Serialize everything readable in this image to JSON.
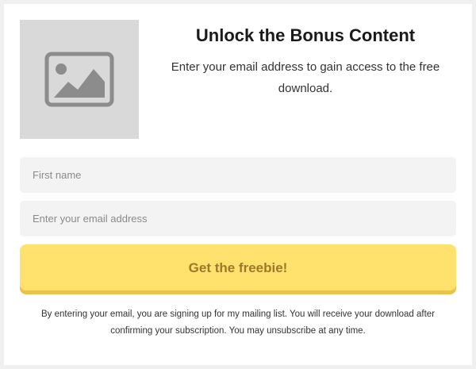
{
  "optin": {
    "image_icon": "image-placeholder-icon",
    "title": "Unlock the Bonus Content",
    "description": "Enter your email address to gain access to the free download.",
    "first_name_placeholder": "First name",
    "first_name_value": "",
    "email_placeholder": "Enter your email address",
    "email_value": "",
    "cta_label": "Get the freebie!",
    "disclaimer": "By entering your email, you are signing up for my mailing list. You will receive your download after confirming your subscription. You may unsubscribe at any time."
  },
  "colors": {
    "card_background": "#ffffff",
    "page_background": "#f0f0f0",
    "image_placeholder_bg": "#d9d9d9",
    "image_icon": "#8c8c8c",
    "input_background": "#f3f3f3",
    "cta_background": "#ffe26e",
    "cta_text": "#9a7a2a"
  }
}
